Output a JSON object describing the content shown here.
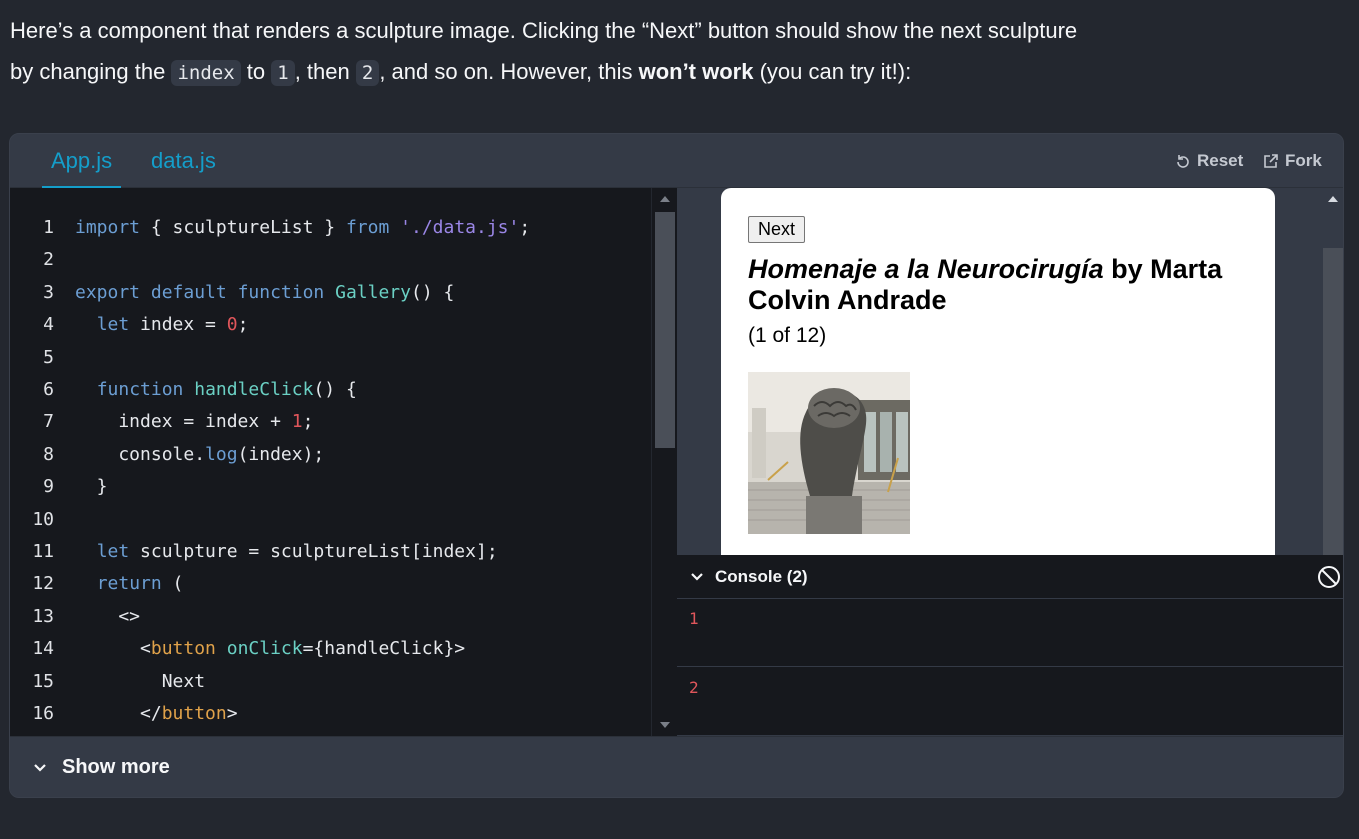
{
  "intro": {
    "line1": "Here’s a component that renders a sculpture image. Clicking the “Next” button should show the next sculpture",
    "line2_a": "by changing the ",
    "code_index": "index",
    "line2_b": " to ",
    "code_1": "1",
    "line2_c": ", then ",
    "code_2": "2",
    "line2_d": ", and so on. However, this ",
    "line2_bold": "won’t work",
    "line2_e": " (you can try it!):"
  },
  "tabs": [
    {
      "label": "App.js",
      "active": true
    },
    {
      "label": "data.js",
      "active": false
    }
  ],
  "toolbar": {
    "reset_label": "Reset",
    "fork_label": "Fork"
  },
  "code": {
    "lines": [
      {
        "n": "1",
        "tokens": [
          [
            "kw",
            "import"
          ],
          [
            "p",
            " { sculptureList } "
          ],
          [
            "kw",
            "from"
          ],
          [
            "p",
            " "
          ],
          [
            "str",
            "'./data.js'"
          ],
          [
            "p",
            ";"
          ]
        ]
      },
      {
        "n": "2",
        "tokens": []
      },
      {
        "n": "3",
        "tokens": [
          [
            "kw",
            "export"
          ],
          [
            "p",
            " "
          ],
          [
            "kw",
            "default"
          ],
          [
            "p",
            " "
          ],
          [
            "kw",
            "function"
          ],
          [
            "p",
            " "
          ],
          [
            "fn",
            "Gallery"
          ],
          [
            "p",
            "() {"
          ]
        ]
      },
      {
        "n": "4",
        "tokens": [
          [
            "p",
            "  "
          ],
          [
            "kw",
            "let"
          ],
          [
            "p",
            " index = "
          ],
          [
            "num",
            "0"
          ],
          [
            "p",
            ";"
          ]
        ]
      },
      {
        "n": "5",
        "tokens": []
      },
      {
        "n": "6",
        "tokens": [
          [
            "p",
            "  "
          ],
          [
            "kw",
            "function"
          ],
          [
            "p",
            " "
          ],
          [
            "fn",
            "handleClick"
          ],
          [
            "p",
            "() {"
          ]
        ]
      },
      {
        "n": "7",
        "tokens": [
          [
            "p",
            "    index = index + "
          ],
          [
            "num",
            "1"
          ],
          [
            "p",
            ";"
          ]
        ]
      },
      {
        "n": "8",
        "tokens": [
          [
            "p",
            "    console."
          ],
          [
            "kw",
            "log"
          ],
          [
            "p",
            "(index);"
          ]
        ]
      },
      {
        "n": "9",
        "tokens": [
          [
            "p",
            "  }"
          ]
        ]
      },
      {
        "n": "10",
        "tokens": []
      },
      {
        "n": "11",
        "tokens": [
          [
            "p",
            "  "
          ],
          [
            "kw",
            "let"
          ],
          [
            "p",
            " sculpture = sculptureList[index];"
          ]
        ]
      },
      {
        "n": "12",
        "tokens": [
          [
            "p",
            "  "
          ],
          [
            "kw",
            "return"
          ],
          [
            "p",
            " ("
          ]
        ]
      },
      {
        "n": "13",
        "tokens": [
          [
            "p",
            "    <>"
          ]
        ]
      },
      {
        "n": "14",
        "tokens": [
          [
            "p",
            "      <"
          ],
          [
            "tag",
            "button"
          ],
          [
            "p",
            " "
          ],
          [
            "attr",
            "onClick"
          ],
          [
            "p",
            "={handleClick}>"
          ]
        ]
      },
      {
        "n": "15",
        "tokens": [
          [
            "p",
            "        Next"
          ]
        ]
      },
      {
        "n": "16",
        "tokens": [
          [
            "p",
            "      </"
          ],
          [
            "tag",
            "button"
          ],
          [
            "p",
            ">"
          ]
        ]
      }
    ]
  },
  "preview": {
    "next_label": "Next",
    "title_italic": "Homenaje a la Neurocirugía",
    "title_rest": " by Marta Colvin Andrade",
    "counter": "(1 of 12)"
  },
  "console": {
    "title": "Console (2)",
    "logs": [
      "1",
      "2"
    ]
  },
  "show_more_label": "Show more",
  "colors": {
    "page_bg": "#23272f",
    "accent": "#149eca",
    "editor_bg": "#16181d",
    "log_red": "#e0565b"
  }
}
